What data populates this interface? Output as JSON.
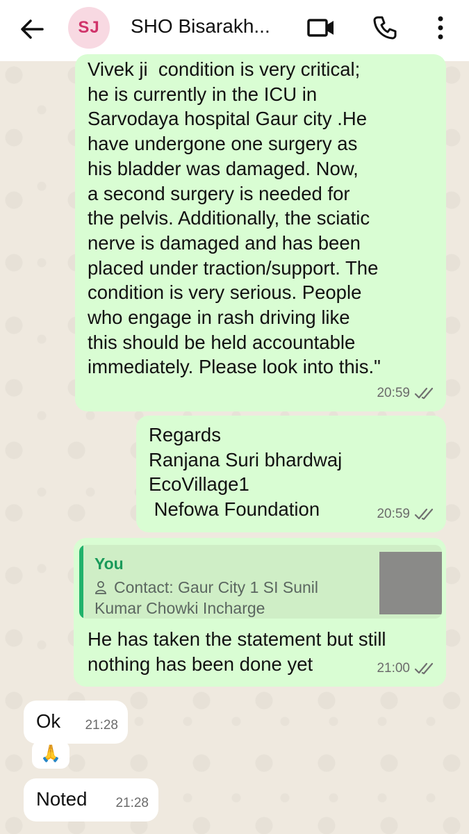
{
  "header": {
    "avatar_initials": "SJ",
    "contact_name": "SHO Bisarakh...",
    "icons": [
      "back-arrow-icon",
      "video-call-icon",
      "phone-call-icon",
      "more-options-icon"
    ]
  },
  "messages": {
    "msg1": {
      "lines": [
        "Vivek ji  condition is very critical;",
        "he is currently in the ICU in",
        "Sarvodaya hospital Gaur city .He",
        "have undergone one surgery as",
        "his bladder was damaged. Now,",
        "a second surgery is needed for",
        "the pelvis. Additionally, the sciatic",
        "nerve is damaged and has been",
        "placed under traction/support. The",
        "condition is very serious. People",
        "who engage in rash driving like",
        "this should be held accountable",
        "immediately. Please look into this.\""
      ],
      "time": "20:59"
    },
    "msg2": {
      "lines": [
        "Regards",
        "Ranjana Suri bhardwaj",
        "EcoVillage1",
        " Nefowa Foundation"
      ],
      "time": "20:59"
    },
    "msg3": {
      "quote_author": "You",
      "quote_text_line1": "Contact: Gaur City 1 SI Sunil",
      "quote_text_line2": "Kumar Chowki Incharge",
      "lines": [
        "He has taken the statement but still",
        "nothing has been done yet"
      ],
      "time": "21:00"
    },
    "msg4": {
      "text": "Ok",
      "time": "21:28"
    },
    "msg5": {
      "emoji": "🙏"
    },
    "msg6": {
      "text": "Noted",
      "time": "21:28"
    }
  },
  "colors": {
    "outgoing_bubble": "#d9fdd3",
    "incoming_bubble": "#ffffff",
    "avatar_bg": "#f8d9e2",
    "avatar_text": "#d0336a",
    "quote_accent": "#21b26b"
  }
}
